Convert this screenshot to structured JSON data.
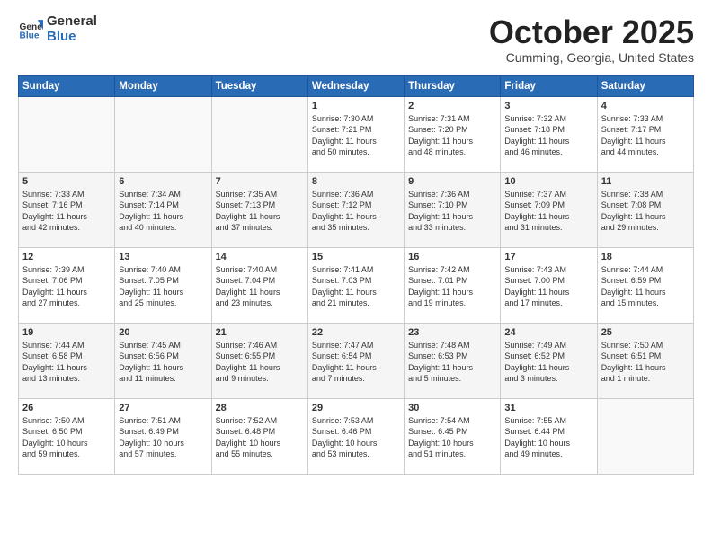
{
  "header": {
    "logo_general": "General",
    "logo_blue": "Blue",
    "title": "October 2025",
    "location": "Cumming, Georgia, United States"
  },
  "weekdays": [
    "Sunday",
    "Monday",
    "Tuesday",
    "Wednesday",
    "Thursday",
    "Friday",
    "Saturday"
  ],
  "weeks": [
    [
      {
        "day": "",
        "info": ""
      },
      {
        "day": "",
        "info": ""
      },
      {
        "day": "",
        "info": ""
      },
      {
        "day": "1",
        "info": "Sunrise: 7:30 AM\nSunset: 7:21 PM\nDaylight: 11 hours\nand 50 minutes."
      },
      {
        "day": "2",
        "info": "Sunrise: 7:31 AM\nSunset: 7:20 PM\nDaylight: 11 hours\nand 48 minutes."
      },
      {
        "day": "3",
        "info": "Sunrise: 7:32 AM\nSunset: 7:18 PM\nDaylight: 11 hours\nand 46 minutes."
      },
      {
        "day": "4",
        "info": "Sunrise: 7:33 AM\nSunset: 7:17 PM\nDaylight: 11 hours\nand 44 minutes."
      }
    ],
    [
      {
        "day": "5",
        "info": "Sunrise: 7:33 AM\nSunset: 7:16 PM\nDaylight: 11 hours\nand 42 minutes."
      },
      {
        "day": "6",
        "info": "Sunrise: 7:34 AM\nSunset: 7:14 PM\nDaylight: 11 hours\nand 40 minutes."
      },
      {
        "day": "7",
        "info": "Sunrise: 7:35 AM\nSunset: 7:13 PM\nDaylight: 11 hours\nand 37 minutes."
      },
      {
        "day": "8",
        "info": "Sunrise: 7:36 AM\nSunset: 7:12 PM\nDaylight: 11 hours\nand 35 minutes."
      },
      {
        "day": "9",
        "info": "Sunrise: 7:36 AM\nSunset: 7:10 PM\nDaylight: 11 hours\nand 33 minutes."
      },
      {
        "day": "10",
        "info": "Sunrise: 7:37 AM\nSunset: 7:09 PM\nDaylight: 11 hours\nand 31 minutes."
      },
      {
        "day": "11",
        "info": "Sunrise: 7:38 AM\nSunset: 7:08 PM\nDaylight: 11 hours\nand 29 minutes."
      }
    ],
    [
      {
        "day": "12",
        "info": "Sunrise: 7:39 AM\nSunset: 7:06 PM\nDaylight: 11 hours\nand 27 minutes."
      },
      {
        "day": "13",
        "info": "Sunrise: 7:40 AM\nSunset: 7:05 PM\nDaylight: 11 hours\nand 25 minutes."
      },
      {
        "day": "14",
        "info": "Sunrise: 7:40 AM\nSunset: 7:04 PM\nDaylight: 11 hours\nand 23 minutes."
      },
      {
        "day": "15",
        "info": "Sunrise: 7:41 AM\nSunset: 7:03 PM\nDaylight: 11 hours\nand 21 minutes."
      },
      {
        "day": "16",
        "info": "Sunrise: 7:42 AM\nSunset: 7:01 PM\nDaylight: 11 hours\nand 19 minutes."
      },
      {
        "day": "17",
        "info": "Sunrise: 7:43 AM\nSunset: 7:00 PM\nDaylight: 11 hours\nand 17 minutes."
      },
      {
        "day": "18",
        "info": "Sunrise: 7:44 AM\nSunset: 6:59 PM\nDaylight: 11 hours\nand 15 minutes."
      }
    ],
    [
      {
        "day": "19",
        "info": "Sunrise: 7:44 AM\nSunset: 6:58 PM\nDaylight: 11 hours\nand 13 minutes."
      },
      {
        "day": "20",
        "info": "Sunrise: 7:45 AM\nSunset: 6:56 PM\nDaylight: 11 hours\nand 11 minutes."
      },
      {
        "day": "21",
        "info": "Sunrise: 7:46 AM\nSunset: 6:55 PM\nDaylight: 11 hours\nand 9 minutes."
      },
      {
        "day": "22",
        "info": "Sunrise: 7:47 AM\nSunset: 6:54 PM\nDaylight: 11 hours\nand 7 minutes."
      },
      {
        "day": "23",
        "info": "Sunrise: 7:48 AM\nSunset: 6:53 PM\nDaylight: 11 hours\nand 5 minutes."
      },
      {
        "day": "24",
        "info": "Sunrise: 7:49 AM\nSunset: 6:52 PM\nDaylight: 11 hours\nand 3 minutes."
      },
      {
        "day": "25",
        "info": "Sunrise: 7:50 AM\nSunset: 6:51 PM\nDaylight: 11 hours\nand 1 minute."
      }
    ],
    [
      {
        "day": "26",
        "info": "Sunrise: 7:50 AM\nSunset: 6:50 PM\nDaylight: 10 hours\nand 59 minutes."
      },
      {
        "day": "27",
        "info": "Sunrise: 7:51 AM\nSunset: 6:49 PM\nDaylight: 10 hours\nand 57 minutes."
      },
      {
        "day": "28",
        "info": "Sunrise: 7:52 AM\nSunset: 6:48 PM\nDaylight: 10 hours\nand 55 minutes."
      },
      {
        "day": "29",
        "info": "Sunrise: 7:53 AM\nSunset: 6:46 PM\nDaylight: 10 hours\nand 53 minutes."
      },
      {
        "day": "30",
        "info": "Sunrise: 7:54 AM\nSunset: 6:45 PM\nDaylight: 10 hours\nand 51 minutes."
      },
      {
        "day": "31",
        "info": "Sunrise: 7:55 AM\nSunset: 6:44 PM\nDaylight: 10 hours\nand 49 minutes."
      },
      {
        "day": "",
        "info": ""
      }
    ]
  ]
}
